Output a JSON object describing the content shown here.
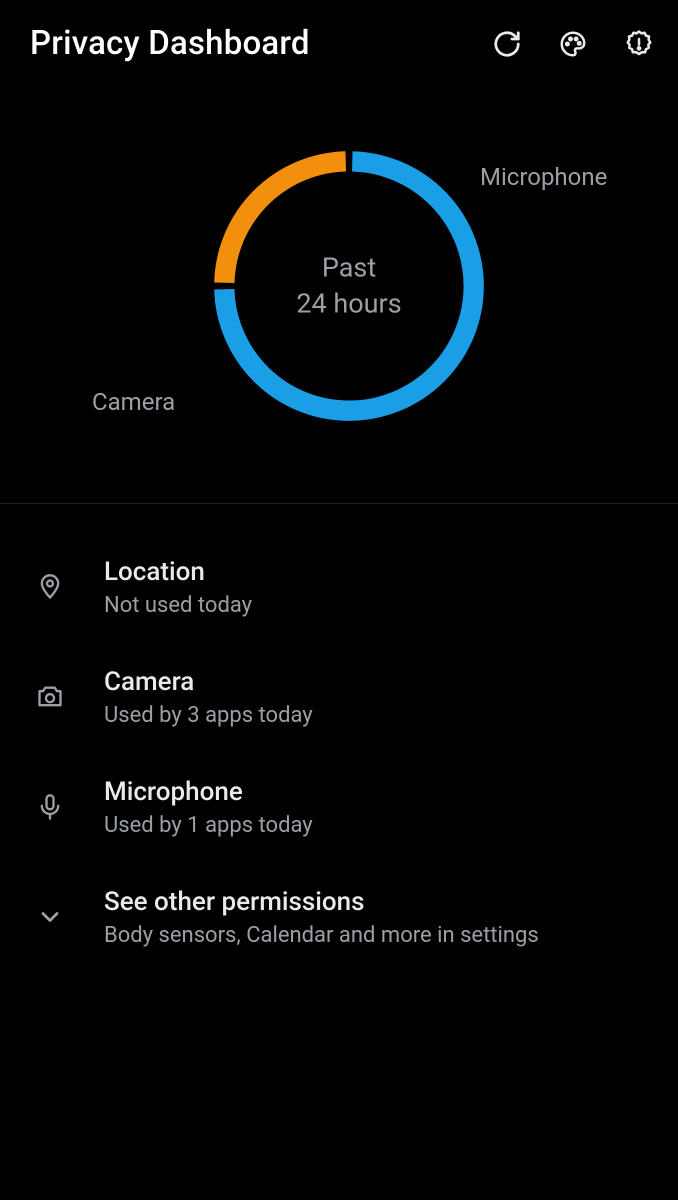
{
  "header": {
    "title": "Privacy Dashboard"
  },
  "chart": {
    "center_line1": "Past",
    "center_line2": "24 hours",
    "camera_label": "Camera",
    "microphone_label": "Microphone"
  },
  "chart_data": {
    "type": "pie",
    "title": "Past 24 hours",
    "series": [
      {
        "name": "Camera",
        "value": 75,
        "color": "#1a9ee5"
      },
      {
        "name": "Microphone",
        "value": 25,
        "color": "#f2900d"
      }
    ]
  },
  "list": {
    "location": {
      "title": "Location",
      "subtitle": "Not used today"
    },
    "camera_row": {
      "title": "Camera",
      "subtitle": "Used by 3 apps today"
    },
    "microphone_row": {
      "title": "Microphone",
      "subtitle": "Used by 1 apps today"
    },
    "other": {
      "title": "See other permissions",
      "subtitle": "Body sensors, Calendar and more in settings"
    }
  }
}
